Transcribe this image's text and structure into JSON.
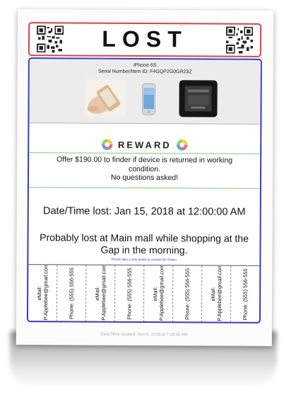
{
  "poster": {
    "title": "LOST",
    "device_name": "iPhone 6S",
    "serial": "Serial Number/Item ID: F4GQP2G0GR23Z",
    "reward": {
      "title": "REWARD",
      "line1": "Offer $190.00 to finder if device is returned in working condition.",
      "line2": "No questions asked!"
    },
    "date_lost": "Date/Time lost: Jan 15, 2018 at 12:00:00 AM",
    "location": "Probably lost at Main mall while shopping at the Gap in the morning.",
    "instruction": "Please take a strip below to contact the Owner",
    "tabs": [
      {
        "email": "eMail: P.Applebee@gmail.com"
      },
      {
        "phone": "Phone: (555) 556-555"
      },
      {
        "email": "eMail: P.Applebee@gmail.com"
      },
      {
        "phone": "Phone: (555) 556-555"
      },
      {
        "email": "eMail: P.Applebee@gmail.com"
      },
      {
        "phone": "Phone: (555) 556-555"
      },
      {
        "email": "eMail: P.Applebee@gmail.com"
      },
      {
        "phone": "Phone: (555) 556-555"
      }
    ],
    "footer": "Date/Time created: Nov 6, 2018 at 7:08:05 AM"
  },
  "icons": [
    "qr-code-icon",
    "reward-icon",
    "hand-phone-image",
    "iphone-image",
    "tablet-box-image"
  ],
  "colors": {
    "header_border": "#d64545",
    "main_border": "#3a3ac8",
    "divider_green": "#7ecb7e",
    "device_bg": "#ececec"
  }
}
